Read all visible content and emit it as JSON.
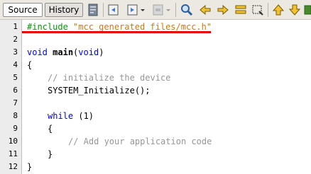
{
  "tabs": {
    "source": "Source",
    "history": "History"
  },
  "toolbar_icons": [
    "last-edit-icon",
    "back-icon",
    "forward-icon",
    "find-icon",
    "find-previous-icon",
    "find-next-icon",
    "toggle-highlight-icon",
    "toggle-rectangular-selection-icon",
    "previous-bookmark-icon",
    "next-bookmark-icon",
    "toggle-bookmark-icon"
  ],
  "colors": {
    "keyword": "#0000e6",
    "string": "#ce7b00",
    "preprocessor": "#009900",
    "comment": "#969696",
    "highlight_underline": "#e60000"
  },
  "line_numbers": [
    "1",
    "2",
    "3",
    "4",
    "5",
    "6",
    "7",
    "8",
    "9",
    "10",
    "11",
    "12"
  ],
  "code": {
    "l1": {
      "directive": "#include",
      "file": "\"mcc_generated_files/mcc.h\""
    },
    "l3": {
      "type": "void",
      "name": "main",
      "open": "(",
      "param": "void",
      "close": ")"
    },
    "l4": "{",
    "l5": "// initialize the device",
    "l6": "SYSTEM_Initialize();",
    "l8": {
      "keyword": "while",
      "rest": " (1)"
    },
    "l9": "{",
    "l10": "// Add your application code",
    "l11": "}",
    "l12": "}"
  }
}
